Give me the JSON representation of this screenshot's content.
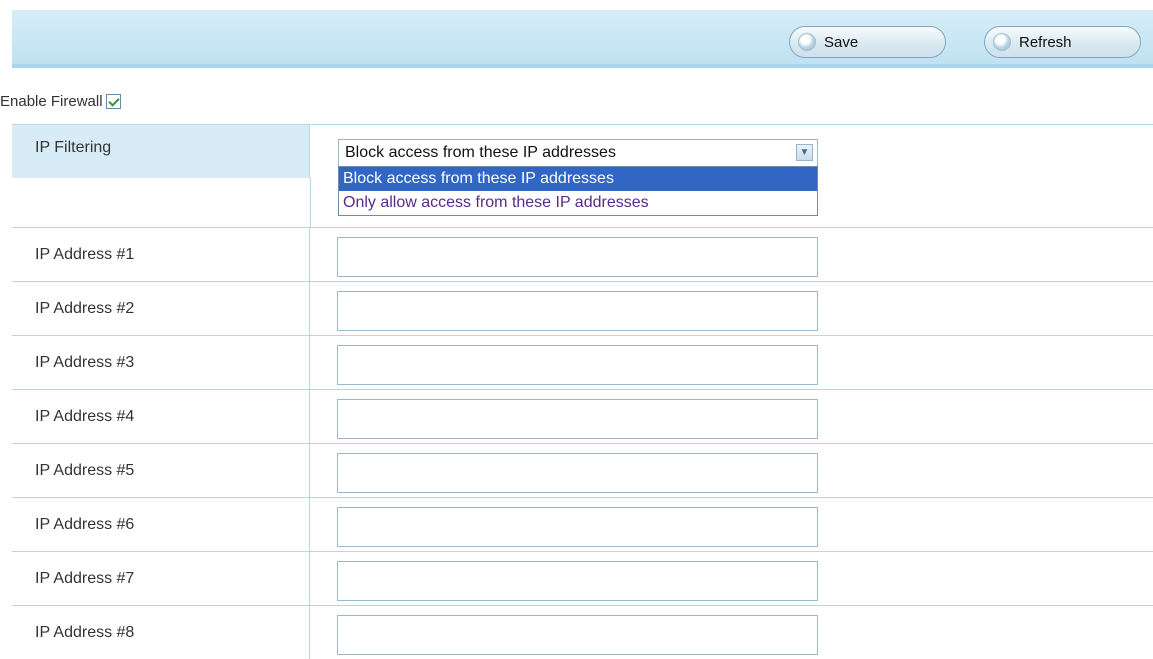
{
  "toolbar": {
    "save_label": "Save",
    "refresh_label": "Refresh"
  },
  "firewall": {
    "enable_label": "Enable Firewall",
    "enabled": true
  },
  "ip_filtering": {
    "label": "IP Filtering",
    "selected_value": "Block access from these IP addresses",
    "options": [
      "Block access from these IP addresses",
      "Only allow access from these IP addresses"
    ]
  },
  "ip_addresses": [
    {
      "label": "IP Address #1",
      "value": ""
    },
    {
      "label": "IP Address #2",
      "value": ""
    },
    {
      "label": "IP Address #3",
      "value": ""
    },
    {
      "label": "IP Address #4",
      "value": ""
    },
    {
      "label": "IP Address #5",
      "value": ""
    },
    {
      "label": "IP Address #6",
      "value": ""
    },
    {
      "label": "IP Address #7",
      "value": ""
    },
    {
      "label": "IP Address #8",
      "value": ""
    }
  ]
}
